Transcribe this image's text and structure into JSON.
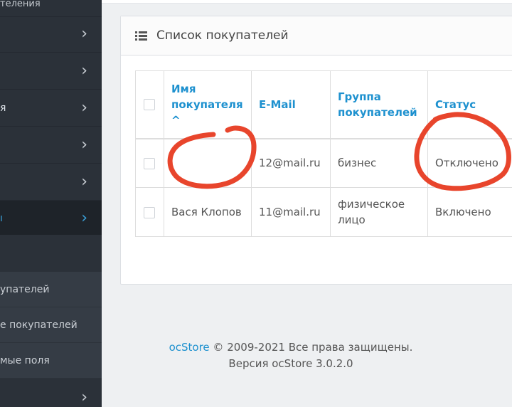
{
  "sidebar": {
    "top_partial": "теления",
    "items": [
      {
        "label": ""
      },
      {
        "label": ""
      },
      {
        "label": "я"
      },
      {
        "label": ""
      },
      {
        "label": ""
      },
      {
        "label": "ı"
      }
    ],
    "subitems": [
      {
        "label": "упателей"
      },
      {
        "label": "е покупателей"
      },
      {
        "label": "мые поля"
      }
    ],
    "bottom_item": {
      "label": ""
    }
  },
  "panel": {
    "title": "Список покупателей",
    "icon": "list-icon"
  },
  "table": {
    "headers": {
      "name_line1": "Имя",
      "name_line2": "покупателя",
      "sort_caret": "^",
      "email": "E-Mail",
      "group_line1": "Группа",
      "group_line2": "покупателей",
      "status": "Статус"
    },
    "rows": [
      {
        "name": "",
        "email": "12@mail.ru",
        "group_line1": "бизнес",
        "group_line2": "",
        "status": "Отключено"
      },
      {
        "name": "Вася Клопов",
        "email": "11@mail.ru",
        "group_line1": "физическое",
        "group_line2": "лицо",
        "status": "Включено"
      }
    ]
  },
  "footer": {
    "brand": "ocStore",
    "copyright": " © 2009-2021 Все права защищены.",
    "version": "Версия ocStore 3.0.2.0"
  },
  "colors": {
    "sidebar_bg": "#2b3139",
    "link_blue": "#1e91cf",
    "annotation_red": "#e8452c"
  }
}
